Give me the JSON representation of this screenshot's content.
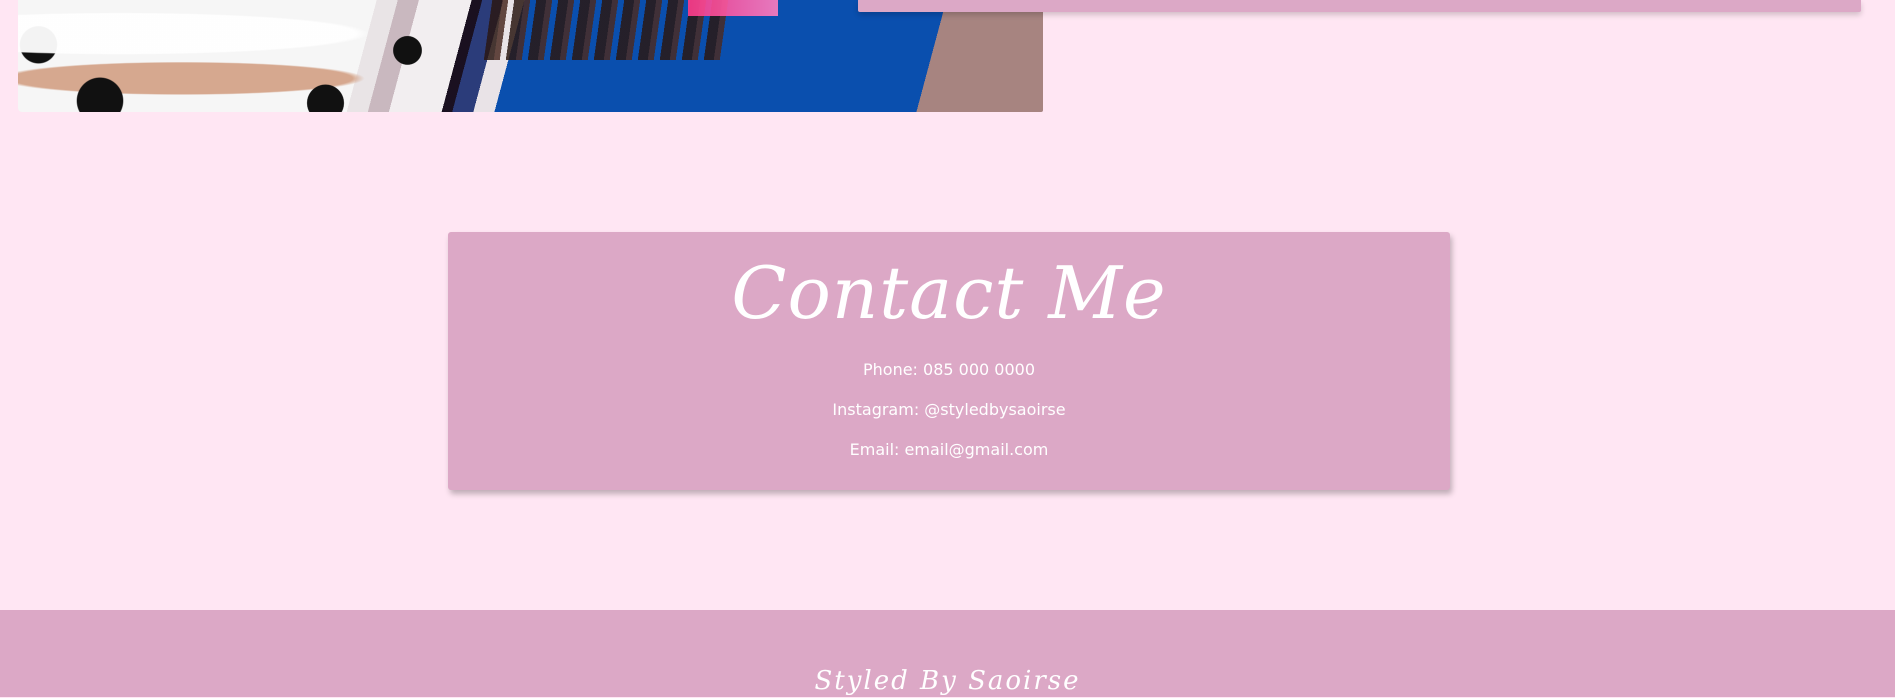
{
  "contact": {
    "title": "Contact Me",
    "phone": "Phone: 085 000 0000",
    "instagram": "Instagram: @styledbysaoirse",
    "email": "Email: email@gmail.com"
  },
  "footer": {
    "brand": "Styled By Saoirse"
  },
  "colors": {
    "page_background": "#ffe6f3",
    "card_pink": "#dca8c6",
    "text_white": "#ffffff"
  }
}
